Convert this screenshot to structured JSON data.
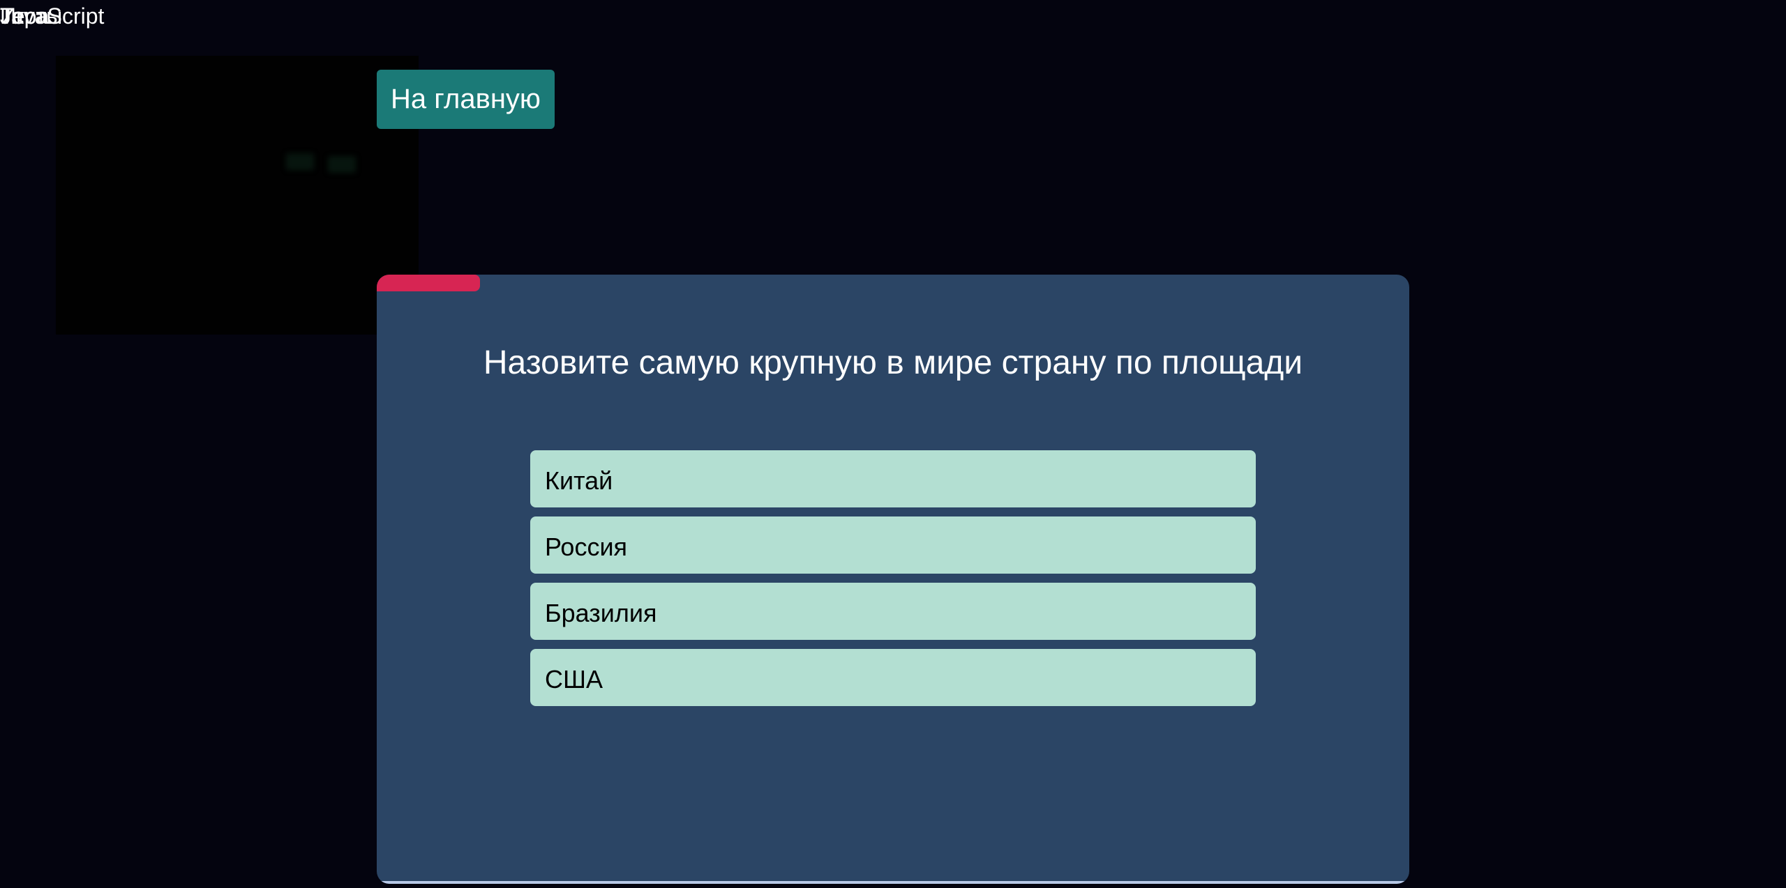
{
  "overlap_labels": [
    "JavaScript",
    "Игра",
    "Тест",
    "Тесты"
  ],
  "home_button": {
    "label": "На главную"
  },
  "quiz": {
    "progress_fraction": 0.1,
    "question": "Назовите самую крупную в мире страну по площади",
    "answers": [
      {
        "label": "Китай"
      },
      {
        "label": "Россия"
      },
      {
        "label": "Бразилия"
      },
      {
        "label": "США"
      }
    ]
  },
  "colors": {
    "background": "#04040f",
    "card": "#2b4565",
    "home_button": "#1b7a77",
    "progress": "#d72553",
    "answer": "#b3dfd2"
  }
}
